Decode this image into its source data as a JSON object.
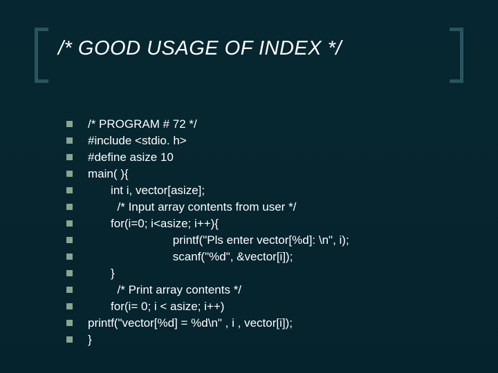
{
  "title": "/* GOOD USAGE OF INDEX */",
  "lines": [
    "/* PROGRAM # 72 */",
    "#include <stdio. h>",
    "#define asize 10",
    "main( ){",
    "       int i, vector[asize];",
    "         /* Input array contents from user */",
    "       for(i=0; i<asize; i++){",
    "                          printf(\"Pls enter vector[%d]: \\n\", i);",
    "                          scanf(\"%d\", &vector[i]);",
    "       }",
    "         /* Print array contents */",
    "       for(i= 0; i < asize; i++)",
    "printf(\"vector[%d] = %d\\n\" , i , vector[i]);",
    "}"
  ]
}
